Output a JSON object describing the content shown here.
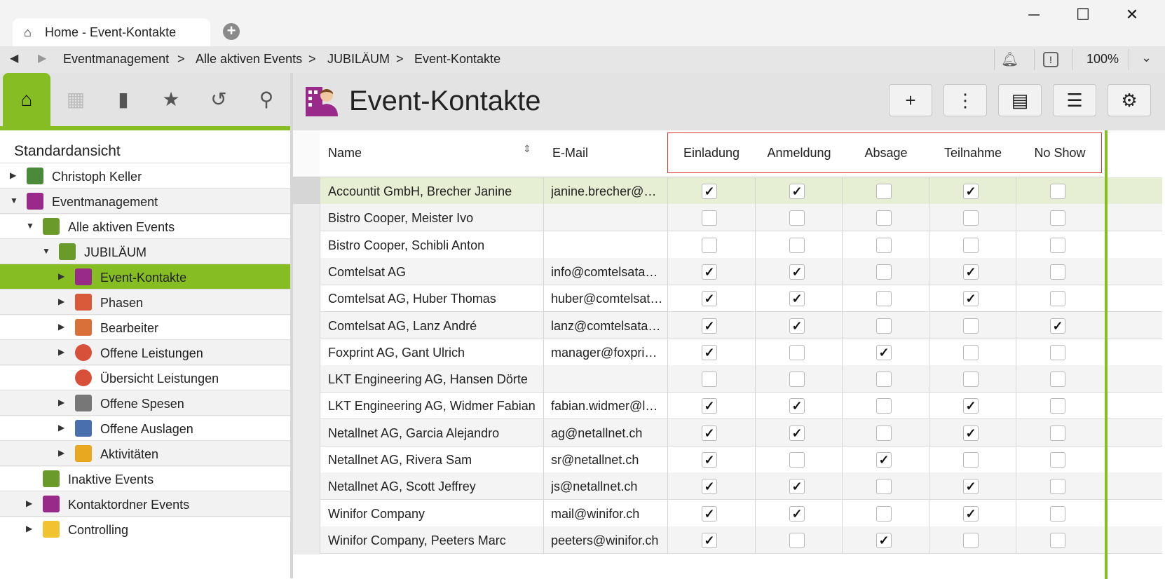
{
  "window": {
    "tab_title": "Home - Event-Kontakte",
    "tab_icon": "home-icon",
    "minimize": "─",
    "maximize": "☐",
    "close": "✕"
  },
  "addressbar": {
    "breadcrumbs": [
      "Eventmanagement",
      "Alle aktiven Events",
      "JUBILÄUM",
      "Event-Kontakte"
    ],
    "separator": ">",
    "zoom": "100%"
  },
  "sidebar": {
    "view_title": "Standardansicht",
    "tree": [
      {
        "label": "Christoph Keller",
        "level": 0,
        "arrow": "▶",
        "icon": "person-icon"
      },
      {
        "label": "Eventmanagement",
        "level": 0,
        "arrow": "▼",
        "icon": "event-contacts-icon"
      },
      {
        "label": "Alle aktiven Events",
        "level": 1,
        "arrow": "▼",
        "icon": "event-book-icon"
      },
      {
        "label": "JUBILÄUM",
        "level": 2,
        "arrow": "▼",
        "icon": "event-book-icon"
      },
      {
        "label": "Event-Kontakte",
        "level": 3,
        "arrow": "▶",
        "icon": "event-contacts-icon"
      },
      {
        "label": "Phasen",
        "level": 3,
        "arrow": "▶",
        "icon": "phases-icon"
      },
      {
        "label": "Bearbeiter",
        "level": 3,
        "arrow": "▶",
        "icon": "workers-icon"
      },
      {
        "label": "Offene Leistungen",
        "level": 3,
        "arrow": "▶",
        "icon": "pie-icon"
      },
      {
        "label": "Übersicht Leistungen",
        "level": 3,
        "arrow": "",
        "icon": "pie-icon"
      },
      {
        "label": "Offene Spesen",
        "level": 3,
        "arrow": "▶",
        "icon": "receipt-icon"
      },
      {
        "label": "Offene Auslagen",
        "level": 3,
        "arrow": "▶",
        "icon": "calculator-icon"
      },
      {
        "label": "Aktivitäten",
        "level": 3,
        "arrow": "▶",
        "icon": "star-icon"
      },
      {
        "label": "Inaktive Events",
        "level": 1,
        "arrow": "",
        "icon": "event-book-icon"
      },
      {
        "label": "Kontaktordner Events",
        "level": 1,
        "arrow": "▶",
        "icon": "event-contacts-icon"
      },
      {
        "label": "Controlling",
        "level": 1,
        "arrow": "▶",
        "icon": "folder-icon"
      }
    ]
  },
  "main": {
    "title": "Event-Kontakte",
    "columns": {
      "name": "Name",
      "email": "E-Mail",
      "flags": [
        "Einladung",
        "Anmeldung",
        "Absage",
        "Teilnahme",
        "No Show"
      ]
    },
    "rows": [
      {
        "name": "Accountit GmbH, Brecher Janine",
        "email": "janine.brecher@ac...",
        "flags": [
          true,
          true,
          false,
          true,
          false
        ]
      },
      {
        "name": "Bistro Cooper, Meister Ivo",
        "email": "",
        "flags": [
          false,
          false,
          false,
          false,
          false
        ]
      },
      {
        "name": "Bistro Cooper, Schibli Anton",
        "email": "",
        "flags": [
          false,
          false,
          false,
          false,
          false
        ]
      },
      {
        "name": "Comtelsat AG",
        "email": "info@comtelsatag....",
        "flags": [
          true,
          true,
          false,
          true,
          false
        ]
      },
      {
        "name": "Comtelsat AG, Huber Thomas",
        "email": "huber@comtelsata...",
        "flags": [
          true,
          true,
          false,
          true,
          false
        ]
      },
      {
        "name": "Comtelsat AG, Lanz André",
        "email": "lanz@comtelsatag....",
        "flags": [
          true,
          true,
          false,
          false,
          true
        ]
      },
      {
        "name": "Foxprint AG, Gant Ulrich",
        "email": "manager@foxprint...",
        "flags": [
          true,
          false,
          true,
          false,
          false
        ]
      },
      {
        "name": "LKT Engineering AG, Hansen Dörte",
        "email": "",
        "flags": [
          false,
          false,
          false,
          false,
          false
        ]
      },
      {
        "name": "LKT Engineering AG, Widmer Fabian",
        "email": "fabian.widmer@lkt...",
        "flags": [
          true,
          true,
          false,
          true,
          false
        ]
      },
      {
        "name": "Netallnet AG, Garcia Alejandro",
        "email": "ag@netallnet.ch",
        "flags": [
          true,
          true,
          false,
          true,
          false
        ]
      },
      {
        "name": "Netallnet AG, Rivera Sam",
        "email": "sr@netallnet.ch",
        "flags": [
          true,
          false,
          true,
          false,
          false
        ]
      },
      {
        "name": "Netallnet AG, Scott Jeffrey",
        "email": "js@netallnet.ch",
        "flags": [
          true,
          true,
          false,
          true,
          false
        ]
      },
      {
        "name": "Winifor Company",
        "email": "mail@winifor.ch",
        "flags": [
          true,
          true,
          false,
          true,
          false
        ]
      },
      {
        "name": "Winifor Company, Peeters Marc",
        "email": "peeters@winifor.ch",
        "flags": [
          true,
          false,
          true,
          false,
          false
        ]
      }
    ]
  },
  "colors": {
    "accent_green": "#86bd23",
    "highlight_red": "#e03030"
  }
}
